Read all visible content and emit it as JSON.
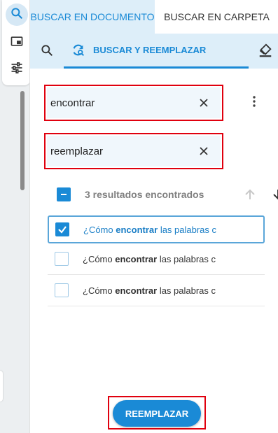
{
  "tabs": {
    "document_label": "BUSCAR EN DOCUMENTO",
    "folder_label": "BUSCAR EN CARPETA"
  },
  "subtabs": {
    "replace_label": "BUSCAR Y REEMPLAZAR"
  },
  "find": {
    "value": "encontrar"
  },
  "replace": {
    "value": "reemplazar"
  },
  "results": {
    "count_label": "3 resultados encontrados",
    "items": [
      {
        "before": "¿Cómo ",
        "match": "encontrar",
        "after": " las palabras c",
        "checked": true
      },
      {
        "before": "¿Cómo ",
        "match": "encontrar",
        "after": " las palabras c",
        "checked": false
      },
      {
        "before": "¿Cómo ",
        "match": "encontrar",
        "after": " las palabras c",
        "checked": false
      }
    ]
  },
  "actions": {
    "replace_label": "REEMPLAZAR"
  },
  "colors": {
    "accent": "#1a8ad6",
    "highlight_border": "#e0000e",
    "active_tab_bg": "#ddeef9"
  },
  "icons": {
    "rail": [
      "search-icon",
      "panel-icon",
      "sliders-icon"
    ],
    "subtabs": [
      "search-icon",
      "replace-refresh-icon",
      "eraser-icon"
    ]
  }
}
